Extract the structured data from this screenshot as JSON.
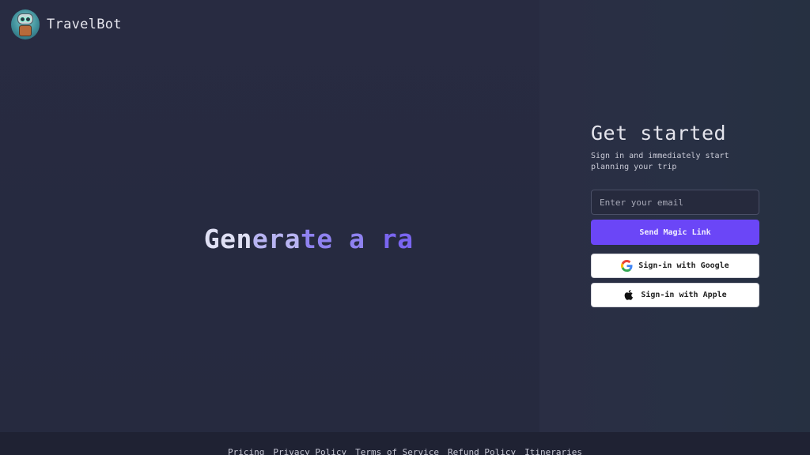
{
  "brand": {
    "name": "TravelBot",
    "logo_icon": "robot-avatar-icon"
  },
  "hero": {
    "segments": [
      "Gen",
      "era",
      "te a",
      " ra"
    ]
  },
  "signin": {
    "title": "Get started",
    "subtitle": "Sign in and immediately start planning your trip",
    "email_placeholder": "Enter your email",
    "magic_link_label": "Send Magic Link",
    "google_label": "Sign-in with Google",
    "apple_label": "Sign-in with Apple"
  },
  "footer": {
    "links": [
      "Pricing",
      "Privacy Policy",
      "Terms of Service",
      "Refund Policy",
      "Itineraries"
    ]
  },
  "colors": {
    "accent": "#6b46f7",
    "background": "#262a40",
    "footer": "#1f2233"
  }
}
